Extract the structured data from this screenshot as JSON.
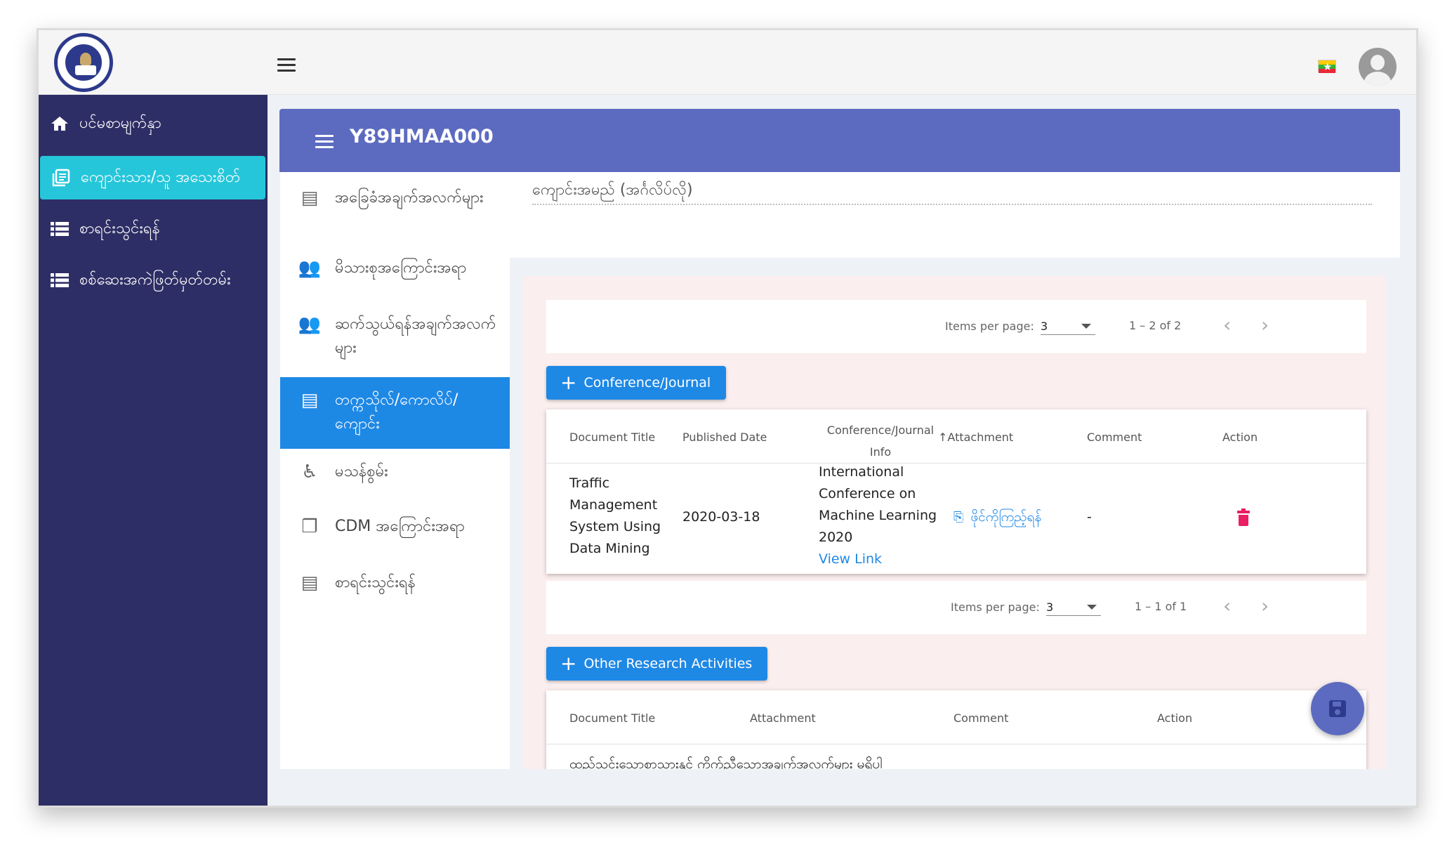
{
  "sidebar": {
    "items": [
      {
        "label": "ပင်မစာမျက်နှာ",
        "icon": "home-icon"
      },
      {
        "label": "ကျောင်းသား/သူ အသေးစိတ်",
        "icon": "article-icon"
      },
      {
        "label": "စာရင်းသွင်းရန်",
        "icon": "list-icon"
      },
      {
        "label": "စစ်ဆေးအကဲဖြတ်မှတ်တမ်း",
        "icon": "list-icon"
      }
    ]
  },
  "header": {
    "title": "Y89HMAA000"
  },
  "tabs": [
    {
      "label": "အခြေခံအချက်အလက်များ",
      "icon": "article-icon"
    },
    {
      "label": "မိသားစုအကြောင်းအရာ",
      "icon": "person-add-icon"
    },
    {
      "label": "ဆက်သွယ်ရန်အချက်အလက်များ",
      "icon": "person-add-icon"
    },
    {
      "label": "တက္ကသိုလ်/ကောလိပ်/ကျောင်း",
      "icon": "article-icon"
    },
    {
      "label": "မသန်စွမ်း",
      "icon": "accessible-icon"
    },
    {
      "label": "CDM အကြောင်းအရာ",
      "icon": "file-copy-icon"
    },
    {
      "label": "စာရင်းသွင်းရန်",
      "icon": "article-icon"
    }
  ],
  "main": {
    "field_label": "ကျောင်းအမည် (အင်္ဂလိပ်လို)",
    "pager1": {
      "items_per_page_label": "Items per page:",
      "page_size": "3",
      "range": "1 – 2 of 2"
    },
    "conference_button": "Conference/Journal",
    "conference_table": {
      "headers": [
        "Document Title",
        "Published Date",
        "Conference/Journal Info",
        "Attachment",
        "Comment",
        "Action"
      ],
      "rows": [
        {
          "document_title": "Traffic Management System Using Data Mining",
          "published_date": "2020-03-18",
          "conference_info": "International Conference on Machine Learning 2020",
          "view_link": "View Link",
          "attachment": "ဖိုင်ကိုကြည့်ရန်",
          "comment": "-"
        }
      ]
    },
    "pager2": {
      "items_per_page_label": "Items per page:",
      "page_size": "3",
      "range": "1 – 1 of 1"
    },
    "other_button": "Other Research Activities",
    "other_table": {
      "headers": [
        "Document Title",
        "Attachment",
        "Comment",
        "Action"
      ],
      "empty_message": "ထည့်သွင်းသောစာသားနှင့် ကိုက်ညီသောအချက်အလက်များ မရှိပါ"
    }
  },
  "colors": {
    "sidebar": "#2e2e66",
    "active_sidebar": "#26c6da",
    "header": "#5c6bc0",
    "primary": "#1e88e5",
    "delete": "#e91e63"
  }
}
